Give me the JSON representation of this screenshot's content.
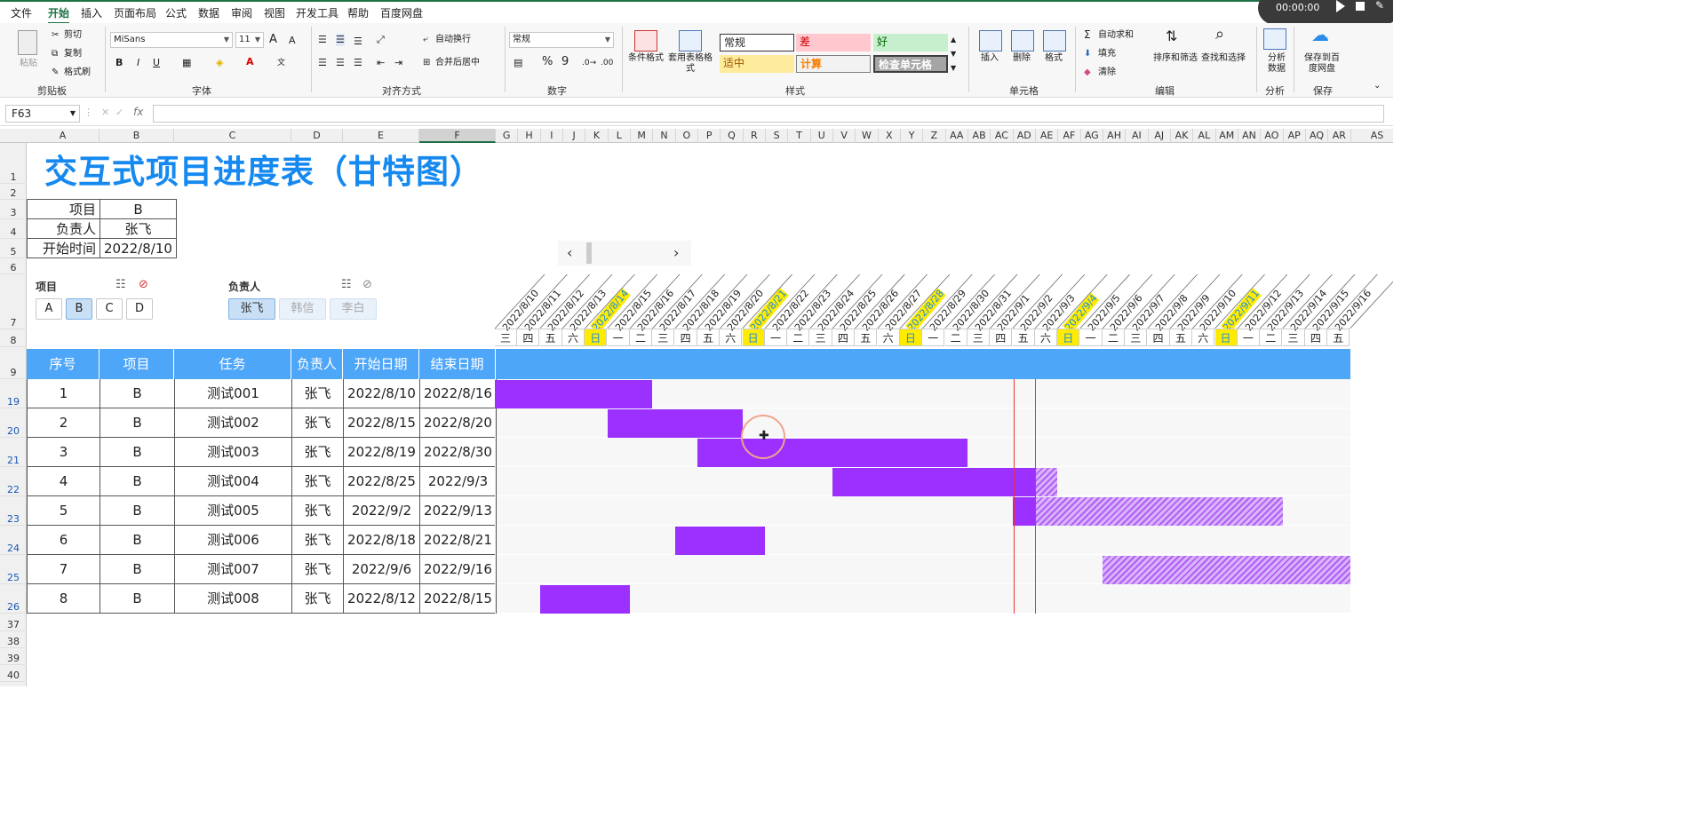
{
  "menu": [
    "文件",
    "开始",
    "插入",
    "页面布局",
    "公式",
    "数据",
    "审阅",
    "视图",
    "开发工具",
    "帮助",
    "百度网盘"
  ],
  "recorder": {
    "time": "00:00:00"
  },
  "ribbon": {
    "clipboard": {
      "paste": "粘贴",
      "cut": "剪切",
      "copy": "复制",
      "format_painter": "格式刷",
      "label": "剪贴板"
    },
    "font": {
      "name": "MiSans",
      "size": "11",
      "grow": "A",
      "shrink": "A",
      "bold": "B",
      "italic": "I",
      "underline": "U",
      "label": "字体"
    },
    "align": {
      "wrap": "自动换行",
      "merge": "合并后居中",
      "label": "对齐方式"
    },
    "number": {
      "format": "常规",
      "percent": "%",
      "comma": "9",
      "label": "数字"
    },
    "styles": {
      "cond": "条件格式",
      "table": "套用表格格式",
      "normal": "常规",
      "bad": "差",
      "good": "好",
      "neutral": "适中",
      "calc": "计算",
      "check": "检查单元格",
      "label": "样式"
    },
    "cells": {
      "insert": "插入",
      "delete": "删除",
      "format": "格式",
      "label": "单元格"
    },
    "editing": {
      "autosum": "自动求和",
      "fill": "填充",
      "clear": "清除",
      "sort": "排序和筛选",
      "find": "查找和选择",
      "label": "编辑"
    },
    "analysis": {
      "analyze": "分析数据",
      "label": "分析"
    },
    "save": {
      "save": "保存到百度网盘",
      "label": "保存"
    },
    "colors": {
      "accent": "#1e7145",
      "bad_bg": "#ffc7ce",
      "good_bg": "#c6efce",
      "neutral_bg": "#ffeb9c"
    }
  },
  "formula_bar": {
    "namebox": "F63",
    "fx": "fx",
    "value": ""
  },
  "columns": [
    "A",
    "B",
    "C",
    "D",
    "E",
    "F",
    "G",
    "H",
    "I",
    "J",
    "K",
    "L",
    "M",
    "N",
    "O",
    "P",
    "Q",
    "R",
    "S",
    "T",
    "U",
    "V",
    "W",
    "X",
    "Y",
    "Z",
    "AA",
    "AB",
    "AC",
    "AD",
    "AE",
    "AF",
    "AG",
    "AH",
    "AI",
    "AJ",
    "AK",
    "AL",
    "AM",
    "AN",
    "AO",
    "AP",
    "AQ",
    "AR",
    "AS"
  ],
  "rows": [
    "1",
    "2",
    "3",
    "4",
    "5",
    "6",
    "7",
    "8",
    "9",
    "19",
    "20",
    "21",
    "22",
    "23",
    "24",
    "25",
    "26",
    "37",
    "38",
    "39",
    "40"
  ],
  "title": "交互式项目进度表（甘特图）",
  "info": {
    "project_label": "项目",
    "project_value": "B",
    "owner_label": "负责人",
    "owner_value": "张飞",
    "start_label": "开始时间",
    "start_value": "2022/8/10"
  },
  "slicers": {
    "project": {
      "title": "项目",
      "items": [
        "A",
        "B",
        "C",
        "D"
      ],
      "selected": "B"
    },
    "owner": {
      "title": "负责人",
      "items": [
        "张飞",
        "韩信",
        "李白"
      ],
      "selected": "张飞"
    }
  },
  "dates": [
    "2022/8/10",
    "2022/8/11",
    "2022/8/12",
    "2022/8/13",
    "2022/8/14",
    "2022/8/15",
    "2022/8/16",
    "2022/8/17",
    "2022/8/18",
    "2022/8/19",
    "2022/8/20",
    "2022/8/21",
    "2022/8/22",
    "2022/8/23",
    "2022/8/24",
    "2022/8/25",
    "2022/8/26",
    "2022/8/27",
    "2022/8/28",
    "2022/8/29",
    "2022/8/30",
    "2022/8/31",
    "2022/9/1",
    "2022/9/2",
    "2022/9/3",
    "2022/9/4",
    "2022/9/5",
    "2022/9/6",
    "2022/9/7",
    "2022/9/8",
    "2022/9/9",
    "2022/9/10",
    "2022/9/11",
    "2022/9/12",
    "2022/9/13",
    "2022/9/14",
    "2022/9/15",
    "2022/9/16"
  ],
  "weekdays": [
    "三",
    "四",
    "五",
    "六",
    "日",
    "一",
    "二",
    "三",
    "四",
    "五",
    "六",
    "日",
    "一",
    "二",
    "三",
    "四",
    "五",
    "六",
    "日",
    "一",
    "二",
    "三",
    "四",
    "五",
    "六",
    "日",
    "一",
    "二",
    "三",
    "四",
    "五",
    "六",
    "日",
    "一",
    "二",
    "三",
    "四",
    "五"
  ],
  "headers": [
    "序号",
    "项目",
    "任务",
    "负责人",
    "开始日期",
    "结束日期"
  ],
  "today": "2022/9/2",
  "tasks": [
    {
      "no": "1",
      "project": "B",
      "task": "测试001",
      "owner": "张飞",
      "start": "2022/8/10",
      "end": "2022/8/16",
      "s": 0,
      "e": 6
    },
    {
      "no": "2",
      "project": "B",
      "task": "测试002",
      "owner": "张飞",
      "start": "2022/8/15",
      "end": "2022/8/20",
      "s": 5,
      "e": 10
    },
    {
      "no": "3",
      "project": "B",
      "task": "测试003",
      "owner": "张飞",
      "start": "2022/8/19",
      "end": "2022/8/30",
      "s": 9,
      "e": 20
    },
    {
      "no": "4",
      "project": "B",
      "task": "测试004",
      "owner": "张飞",
      "start": "2022/8/25",
      "end": "2022/9/3",
      "s": 15,
      "e": 24
    },
    {
      "no": "5",
      "project": "B",
      "task": "测试005",
      "owner": "张飞",
      "start": "2022/9/2",
      "end": "2022/9/13",
      "s": 23,
      "e": 34
    },
    {
      "no": "6",
      "project": "B",
      "task": "测试006",
      "owner": "张飞",
      "start": "2022/8/18",
      "end": "2022/8/21",
      "s": 8,
      "e": 11
    },
    {
      "no": "7",
      "project": "B",
      "task": "测试007",
      "owner": "张飞",
      "start": "2022/9/6",
      "end": "2022/9/16",
      "s": 27,
      "e": 37
    },
    {
      "no": "8",
      "project": "B",
      "task": "测试008",
      "owner": "张飞",
      "start": "2022/8/12",
      "end": "2022/8/15",
      "s": 2,
      "e": 5
    }
  ]
}
